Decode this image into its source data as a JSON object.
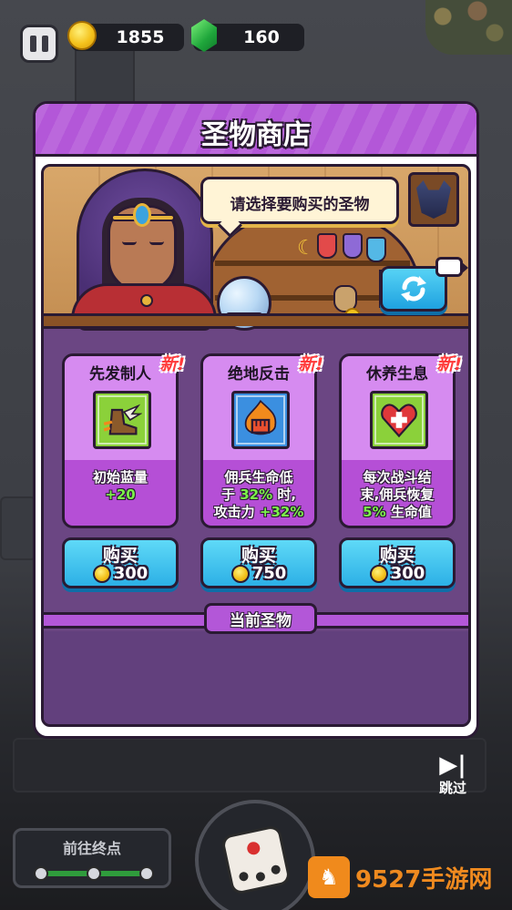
{
  "hud": {
    "coins": "1855",
    "gems": "160"
  },
  "modal": {
    "title": "圣物商店",
    "bubble_text": "请选择要购买的圣物",
    "current_relics_label": "当前圣物"
  },
  "relics": [
    {
      "name": "先发制人",
      "new_badge": "新!",
      "desc_line1": "初始蓝量",
      "desc_hl": "+20",
      "buy_label": "购买",
      "price": "300",
      "icon": "winged-boot-icon",
      "frame_color": "#8bd13a"
    },
    {
      "name": "绝地反击",
      "new_badge": "新!",
      "desc_a": "佣兵生命低",
      "desc_b": "于 ",
      "desc_b_hl": "32%",
      "desc_b_end": " 时,",
      "desc_c": "攻击力 ",
      "desc_c_hl": "+32%",
      "buy_label": "购买",
      "price": "750",
      "icon": "flaming-fist-icon",
      "frame_color": "#3b8fe0"
    },
    {
      "name": "休养生息",
      "new_badge": "新!",
      "desc_a": "每次战斗结",
      "desc_b": "束,佣兵恢复",
      "desc_c_hl": "5%",
      "desc_c": " 生命值",
      "buy_label": "购买",
      "price": "300",
      "icon": "heart-cross-icon",
      "frame_color": "#8bd13a"
    }
  ],
  "bottom": {
    "skip_label": "跳过",
    "goto_label": "前往终点",
    "watermark": "9527手游网"
  },
  "colors": {
    "accent_purple": "#b357d8",
    "buy_blue": "#2cb0e6",
    "highlight_green": "#7cf24a",
    "new_red": "#ff3b3b"
  }
}
